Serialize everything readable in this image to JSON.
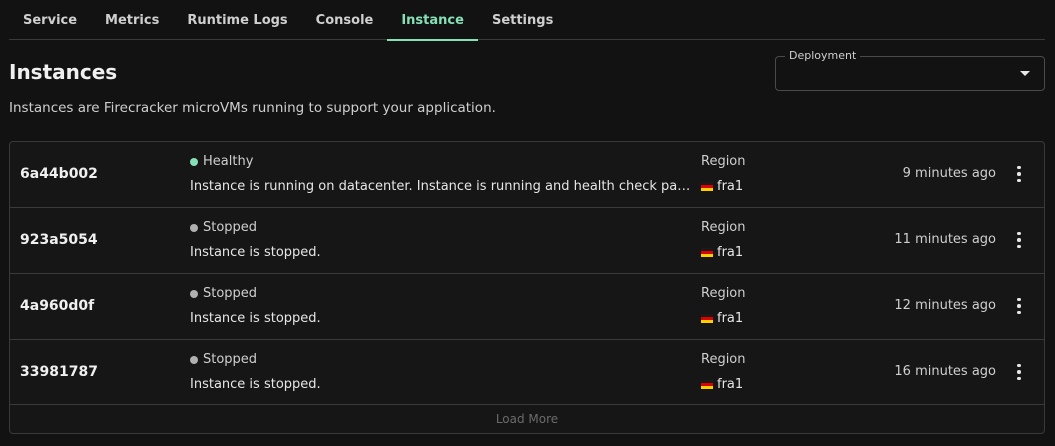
{
  "tabs": [
    {
      "label": "Service",
      "active": false
    },
    {
      "label": "Metrics",
      "active": false
    },
    {
      "label": "Runtime Logs",
      "active": false
    },
    {
      "label": "Console",
      "active": false
    },
    {
      "label": "Instance",
      "active": true
    },
    {
      "label": "Settings",
      "active": false
    }
  ],
  "page": {
    "title": "Instances",
    "description": "Instances are Firecracker microVMs running to support your application."
  },
  "deployment_select": {
    "label": "Deployment",
    "value": ""
  },
  "colors": {
    "accent": "#86e0b6",
    "healthy": "#86e0b6",
    "stopped": "#b0b0b0"
  },
  "instances": [
    {
      "id": "6a44b002",
      "status": "Healthy",
      "status_color": "#86e0b6",
      "message": "Instance is running on datacenter. Instance is running and health check passed.",
      "region_label": "Region",
      "region": "fra1",
      "time": "9 minutes ago"
    },
    {
      "id": "923a5054",
      "status": "Stopped",
      "status_color": "#b0b0b0",
      "message": "Instance is stopped.",
      "region_label": "Region",
      "region": "fra1",
      "time": "11 minutes ago"
    },
    {
      "id": "4a960d0f",
      "status": "Stopped",
      "status_color": "#b0b0b0",
      "message": "Instance is stopped.",
      "region_label": "Region",
      "region": "fra1",
      "time": "12 minutes ago"
    },
    {
      "id": "33981787",
      "status": "Stopped",
      "status_color": "#b0b0b0",
      "message": "Instance is stopped.",
      "region_label": "Region",
      "region": "fra1",
      "time": "16 minutes ago"
    }
  ],
  "load_more_label": "Load More"
}
